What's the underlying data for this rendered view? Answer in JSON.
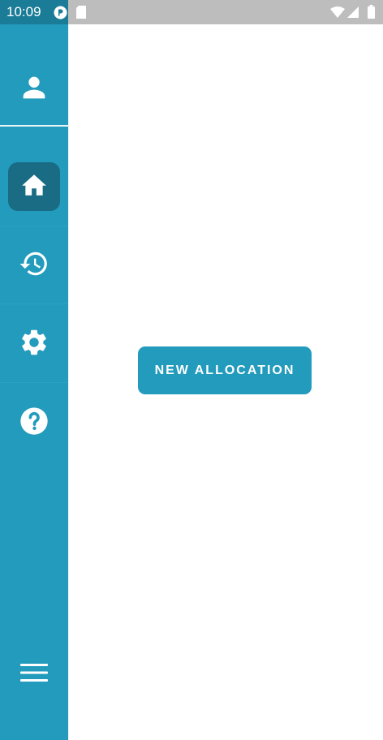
{
  "status_bar": {
    "time": "10:09",
    "icons": [
      "notification-app-icon",
      "sd-card-icon",
      "wifi-icon",
      "signal-icon",
      "battery-icon"
    ],
    "colors": {
      "left_bg": "#1a7c96",
      "right_bg": "#bdbdbd"
    }
  },
  "sidebar": {
    "background": "#229bbd",
    "active_background": "#1a6b84",
    "items": [
      {
        "id": "profile",
        "icon": "person-icon"
      },
      {
        "id": "home",
        "icon": "home-icon",
        "active": true
      },
      {
        "id": "history",
        "icon": "history-icon"
      },
      {
        "id": "settings",
        "icon": "gear-icon"
      },
      {
        "id": "help",
        "icon": "help-icon"
      },
      {
        "id": "menu",
        "icon": "hamburger-menu-icon"
      }
    ]
  },
  "main": {
    "new_allocation_label": "NEW ALLOCATION"
  }
}
